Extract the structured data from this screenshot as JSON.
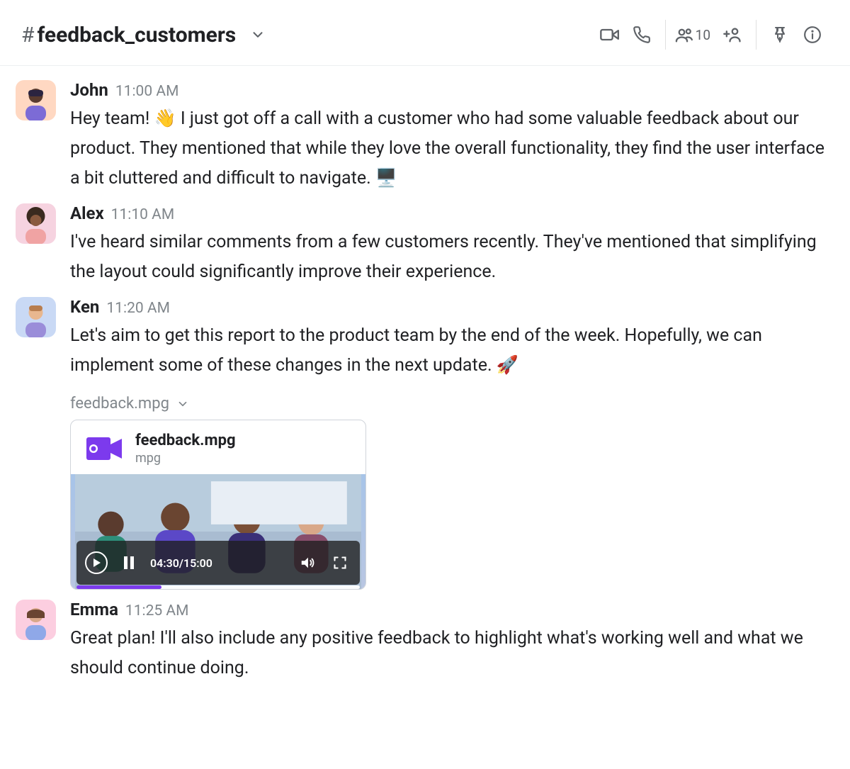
{
  "header": {
    "hash": "#",
    "channel": "feedback_customers",
    "member_count": "10"
  },
  "messages": [
    {
      "author": "John",
      "time": "11:00 AM",
      "avatar_bg": "#ffd8c2",
      "text": "Hey team! 👋 I just got off a call with a customer who had some valuable feedback about our product. They mentioned that while they love the overall functionality, they find the user interface a bit cluttered and difficult to navigate. 🖥️"
    },
    {
      "author": "Alex",
      "time": "11:10 AM",
      "avatar_bg": "#f6d3e0",
      "text": "I've heard similar comments from a few customers recently. They've mentioned that simplifying the layout could significantly improve their experience."
    },
    {
      "author": "Ken",
      "time": "11:20 AM",
      "avatar_bg": "#c9d9f5",
      "text": "Let's aim to get this report to the product team by the end of the week. Hopefully, we can implement some of these changes in the next update. 🚀",
      "attachment": {
        "label": "feedback.mpg",
        "title": "feedback.mpg",
        "ext": "mpg",
        "time": "04:30/15:00",
        "progress_pct": 30
      }
    },
    {
      "author": "Emma",
      "time": "11:25 AM",
      "avatar_bg": "#fccee0",
      "text": "Great plan! I'll also include any positive feedback to highlight what's working well and what we should continue doing."
    }
  ]
}
